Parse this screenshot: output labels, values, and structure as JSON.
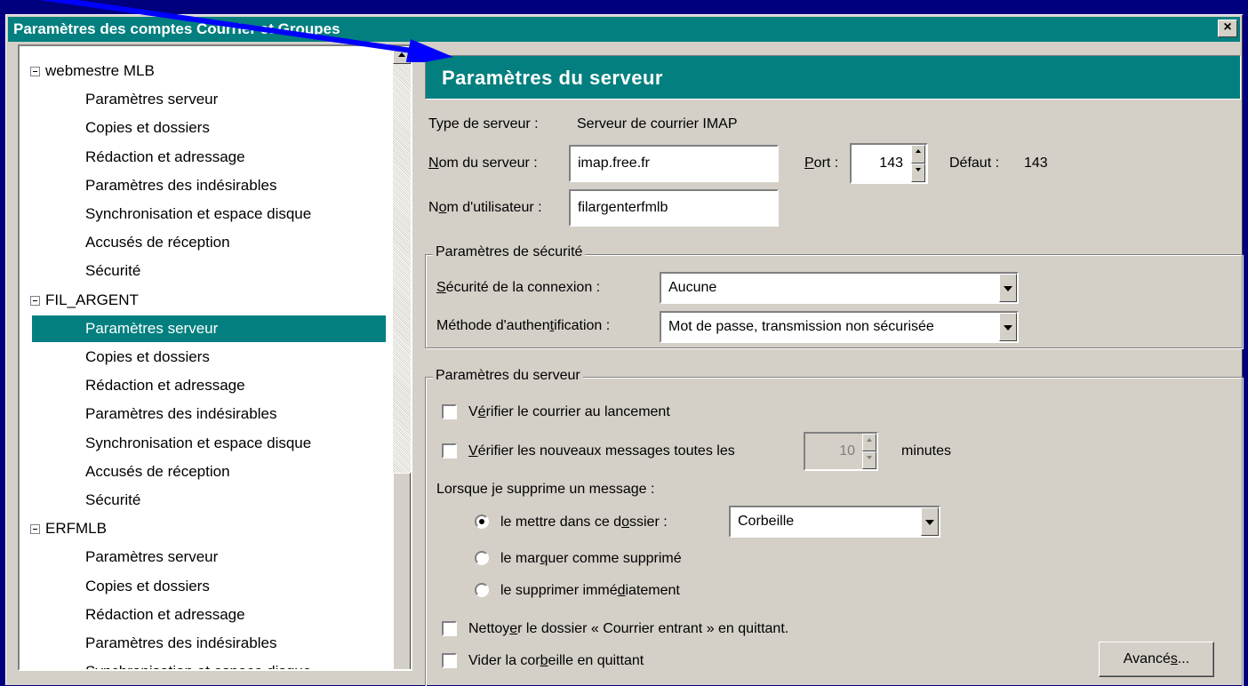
{
  "window": {
    "title": "Paramètres des comptes Courrier et Groupes",
    "close_label": "×"
  },
  "tree": {
    "accounts": [
      {
        "name": "webmestre MLB",
        "items": [
          "Paramètres serveur",
          "Copies et dossiers",
          "Rédaction et adressage",
          "Paramètres des indésirables",
          "Synchronisation et espace disque",
          "Accusés de réception",
          "Sécurité"
        ]
      },
      {
        "name": "FIL_ARGENT",
        "items": [
          "Paramètres serveur",
          "Copies et dossiers",
          "Rédaction et adressage",
          "Paramètres des indésirables",
          "Synchronisation et espace disque",
          "Accusés de réception",
          "Sécurité"
        ]
      },
      {
        "name": "ERFMLB",
        "items": [
          "Paramètres serveur",
          "Copies et dossiers",
          "Rédaction et adressage",
          "Paramètres des indésirables",
          "Synchronisation et espace disque"
        ]
      }
    ],
    "selected": {
      "account": 1,
      "item": 0
    }
  },
  "panel": {
    "title": "Paramètres du serveur",
    "server_type_label": "Type de serveur :",
    "server_type_value": "Serveur de courrier IMAP",
    "server_name_label": "Nom du serveur :",
    "server_name_value": "imap.free.fr",
    "port_label": "Port :",
    "port_value": "143",
    "default_label": "Défaut :",
    "default_value": "143",
    "username_label": "Nom d'utilisateur :",
    "username_value": "filargenterfmlb"
  },
  "security": {
    "group_title": "Paramètres de sécurité",
    "connection_label": "Sécurité de la connexion :",
    "connection_value": "Aucune",
    "auth_label": "Méthode d'authentification :",
    "auth_value": "Mot de passe, transmission non sécurisée"
  },
  "server_settings": {
    "group_title": "Paramètres du serveur",
    "check_startup_label": "Vérifier le courrier au lancement",
    "check_startup_checked": false,
    "check_every_label": "Vérifier les nouveaux messages toutes les",
    "check_every_checked": false,
    "check_every_value": "10",
    "minutes_label": "minutes",
    "on_delete_label": "Lorsque je supprime un message :",
    "move_to_folder_label": "le mettre dans ce dossier :",
    "folder_value": "Corbeille",
    "mark_deleted_label": "le marquer comme supprimé",
    "delete_immediately_label": "le supprimer immédiatement",
    "selected_delete_option": "move_to_folder",
    "expunge_label": "Nettoyer le dossier « Courrier entrant » en quittant.",
    "expunge_checked": false,
    "empty_trash_label": "Vider la corbeille en quittant",
    "empty_trash_checked": false,
    "advanced_button": "Avancés..."
  },
  "colors": {
    "desktop": "#00007e",
    "titlebar": "#037f7f",
    "selection": "#037f7f",
    "arrow": "#0000ff",
    "face": "#d4d0c8"
  }
}
